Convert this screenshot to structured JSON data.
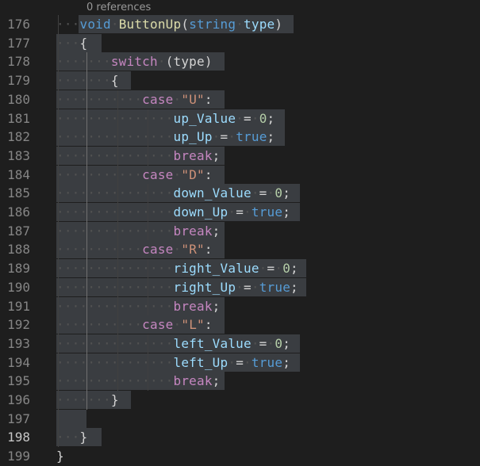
{
  "editor": {
    "codelens": "0 references",
    "lines": [
      {
        "n": "176",
        "sel": [
          99,
          370
        ],
        "tokens": [
          [
            "ws",
            "···"
          ],
          [
            "kw",
            "void"
          ],
          [
            "ws",
            "·"
          ],
          [
            "fn",
            "ButtonUp"
          ],
          [
            "pun",
            "("
          ],
          [
            "kw",
            "string"
          ],
          [
            "ws",
            "·"
          ],
          [
            "var",
            "type"
          ],
          [
            "pun",
            ")"
          ]
        ]
      },
      {
        "n": "177",
        "sel": [
          71,
          128
        ],
        "tokens": [
          [
            "ws",
            "···"
          ],
          [
            "pun",
            "{"
          ]
        ]
      },
      {
        "n": "178",
        "sel": [
          71,
          283
        ],
        "tokens": [
          [
            "ws",
            "·······"
          ],
          [
            "ctl",
            "switch"
          ],
          [
            "ws",
            "·"
          ],
          [
            "pun",
            "(type)"
          ]
        ]
      },
      {
        "n": "179",
        "sel": [
          71,
          165
        ],
        "tokens": [
          [
            "ws",
            "·······"
          ],
          [
            "pun",
            "{"
          ]
        ]
      },
      {
        "n": "180",
        "sel": [
          71,
          283
        ],
        "tokens": [
          [
            "ws",
            "···········"
          ],
          [
            "ctl",
            "case"
          ],
          [
            "ws",
            "·"
          ],
          [
            "str",
            "\"U\""
          ],
          [
            "pun",
            ":"
          ]
        ]
      },
      {
        "n": "181",
        "sel": [
          71,
          359
        ],
        "tokens": [
          [
            "ws",
            "···············"
          ],
          [
            "var",
            "up_Value"
          ],
          [
            "ws",
            "·"
          ],
          [
            "pun",
            "="
          ],
          [
            "ws",
            "·"
          ],
          [
            "num",
            "0"
          ],
          [
            "pun",
            ";"
          ]
        ]
      },
      {
        "n": "182",
        "sel": [
          71,
          359
        ],
        "tokens": [
          [
            "ws",
            "···············"
          ],
          [
            "var",
            "up_Up"
          ],
          [
            "ws",
            "·"
          ],
          [
            "pun",
            "="
          ],
          [
            "ws",
            "·"
          ],
          [
            "kw",
            "true"
          ],
          [
            "pun",
            ";"
          ]
        ]
      },
      {
        "n": "183",
        "sel": [
          71,
          283
        ],
        "tokens": [
          [
            "ws",
            "···············"
          ],
          [
            "ctl",
            "break"
          ],
          [
            "pun",
            ";"
          ]
        ]
      },
      {
        "n": "184",
        "sel": [
          71,
          283
        ],
        "tokens": [
          [
            "ws",
            "···········"
          ],
          [
            "ctl",
            "case"
          ],
          [
            "ws",
            "·"
          ],
          [
            "str",
            "\"D\""
          ],
          [
            "pun",
            ":"
          ]
        ]
      },
      {
        "n": "185",
        "sel": [
          71,
          378
        ],
        "tokens": [
          [
            "ws",
            "···············"
          ],
          [
            "var",
            "down_Value"
          ],
          [
            "ws",
            "·"
          ],
          [
            "pun",
            "="
          ],
          [
            "ws",
            "·"
          ],
          [
            "num",
            "0"
          ],
          [
            "pun",
            ";"
          ]
        ]
      },
      {
        "n": "186",
        "sel": [
          71,
          378
        ],
        "tokens": [
          [
            "ws",
            "···············"
          ],
          [
            "var",
            "down_Up"
          ],
          [
            "ws",
            "·"
          ],
          [
            "pun",
            "="
          ],
          [
            "ws",
            "·"
          ],
          [
            "kw",
            "true"
          ],
          [
            "pun",
            ";"
          ]
        ]
      },
      {
        "n": "187",
        "sel": [
          71,
          283
        ],
        "tokens": [
          [
            "ws",
            "···············"
          ],
          [
            "ctl",
            "break"
          ],
          [
            "pun",
            ";"
          ]
        ]
      },
      {
        "n": "188",
        "sel": [
          71,
          283
        ],
        "tokens": [
          [
            "ws",
            "···········"
          ],
          [
            "ctl",
            "case"
          ],
          [
            "ws",
            "·"
          ],
          [
            "str",
            "\"R\""
          ],
          [
            "pun",
            ":"
          ]
        ]
      },
      {
        "n": "189",
        "sel": [
          71,
          386
        ],
        "tokens": [
          [
            "ws",
            "···············"
          ],
          [
            "var",
            "right_Value"
          ],
          [
            "ws",
            "·"
          ],
          [
            "pun",
            "="
          ],
          [
            "ws",
            "·"
          ],
          [
            "num",
            "0"
          ],
          [
            "pun",
            ";"
          ]
        ]
      },
      {
        "n": "190",
        "sel": [
          71,
          386
        ],
        "tokens": [
          [
            "ws",
            "···············"
          ],
          [
            "var",
            "right_Up"
          ],
          [
            "ws",
            "·"
          ],
          [
            "pun",
            "="
          ],
          [
            "ws",
            "·"
          ],
          [
            "kw",
            "true"
          ],
          [
            "pun",
            ";"
          ]
        ]
      },
      {
        "n": "191",
        "sel": [
          71,
          283
        ],
        "tokens": [
          [
            "ws",
            "···············"
          ],
          [
            "ctl",
            "break"
          ],
          [
            "pun",
            ";"
          ]
        ]
      },
      {
        "n": "192",
        "sel": [
          71,
          283
        ],
        "tokens": [
          [
            "ws",
            "···········"
          ],
          [
            "ctl",
            "case"
          ],
          [
            "ws",
            "·"
          ],
          [
            "str",
            "\"L\""
          ],
          [
            "pun",
            ":"
          ]
        ]
      },
      {
        "n": "193",
        "sel": [
          71,
          378
        ],
        "tokens": [
          [
            "ws",
            "···············"
          ],
          [
            "var",
            "left_Value"
          ],
          [
            "ws",
            "·"
          ],
          [
            "pun",
            "="
          ],
          [
            "ws",
            "·"
          ],
          [
            "num",
            "0"
          ],
          [
            "pun",
            ";"
          ]
        ]
      },
      {
        "n": "194",
        "sel": [
          71,
          378
        ],
        "tokens": [
          [
            "ws",
            "···············"
          ],
          [
            "var",
            "left_Up"
          ],
          [
            "ws",
            "·"
          ],
          [
            "pun",
            "="
          ],
          [
            "ws",
            "·"
          ],
          [
            "kw",
            "true"
          ],
          [
            "pun",
            ";"
          ]
        ]
      },
      {
        "n": "195",
        "sel": [
          71,
          283
        ],
        "tokens": [
          [
            "ws",
            "···············"
          ],
          [
            "ctl",
            "break"
          ],
          [
            "pun",
            ";"
          ]
        ]
      },
      {
        "n": "196",
        "sel": [
          71,
          165
        ],
        "tokens": [
          [
            "ws",
            "·······"
          ],
          [
            "pun",
            "}"
          ]
        ]
      },
      {
        "n": "197",
        "sel": [
          71,
          109
        ],
        "tokens": []
      },
      {
        "n": "198",
        "sel": [
          71,
          128
        ],
        "active": true,
        "tokens": [
          [
            "ws",
            "···"
          ],
          [
            "pun",
            "}"
          ]
        ]
      },
      {
        "n": "199",
        "tokens": [
          [
            "pun",
            "}"
          ]
        ]
      }
    ]
  }
}
